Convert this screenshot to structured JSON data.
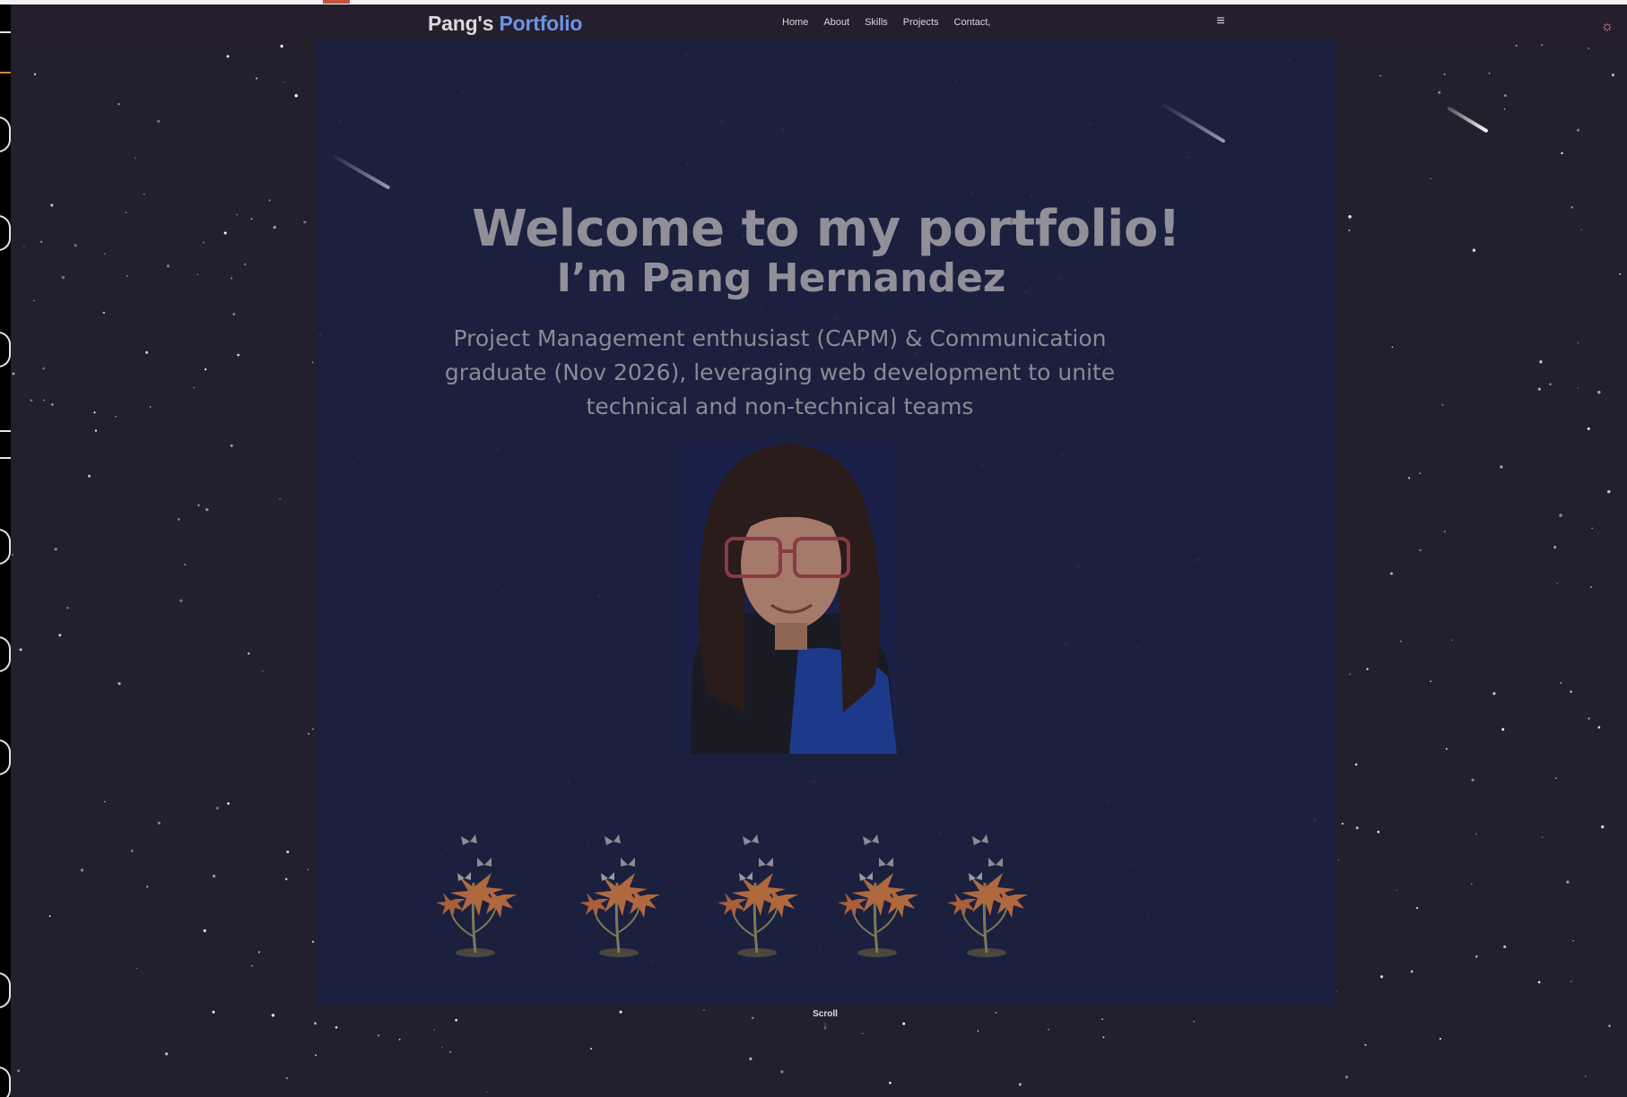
{
  "colors": {
    "page_background": "#231f2c",
    "hero_background": "#1b2140",
    "accent": "#6d94e6",
    "heading_text": "#918f98",
    "nav_text": "#d6d6da"
  },
  "navbar": {
    "logo_prefix": "Pang's",
    "logo_accent": "Portfolio",
    "links": [
      {
        "label": "Home"
      },
      {
        "label": "About"
      },
      {
        "label": "Skills"
      },
      {
        "label": "Projects"
      },
      {
        "label": "Contact,"
      }
    ],
    "menu_icon": "hamburger-menu-icon",
    "theme_icon": "sun-icon"
  },
  "hero": {
    "title": "Welcome to my portfolio!",
    "subtitle": "I’m Pang Hernandez",
    "description": "Project Management enthusiast (CAPM) & Communication graduate (Nov 2026), leveraging web development to unite technical and non-technical teams",
    "photo_icon": "profile-photo",
    "decoration_icon": "flower-butterfly-icon"
  },
  "scroll": {
    "label": "Scroll",
    "icon": "arrow-down-icon"
  }
}
